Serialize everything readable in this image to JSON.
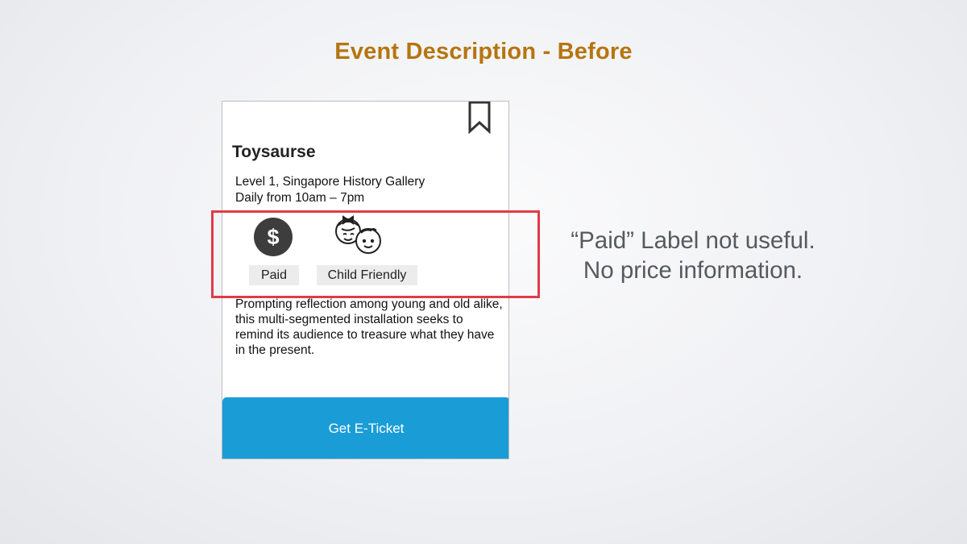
{
  "slide": {
    "title": "Event Description - Before"
  },
  "event_card": {
    "bookmark_icon": "bookmark-outline-icon",
    "title": "Toysaurse",
    "location": "Level 1, Singapore History Gallery",
    "hours": "Daily from 10am – 7pm",
    "tags": [
      {
        "icon": "dollar-icon",
        "label": "Paid"
      },
      {
        "icon": "kids-faces-icon",
        "label": "Child Friendly"
      }
    ],
    "description": "Prompting reflection among young and old alike, this multi-segmented installation seeks to remind its audience to treasure what they have in the present.",
    "button_label": "Get E-Ticket",
    "button_color": "#1a9dd6"
  },
  "highlight": {
    "color": "#e03b47"
  },
  "annotation": {
    "line1": "“Paid” Label not useful.",
    "line2": "No price information."
  },
  "colors": {
    "title": "#b5750f",
    "annotation_text": "#555a5f"
  }
}
